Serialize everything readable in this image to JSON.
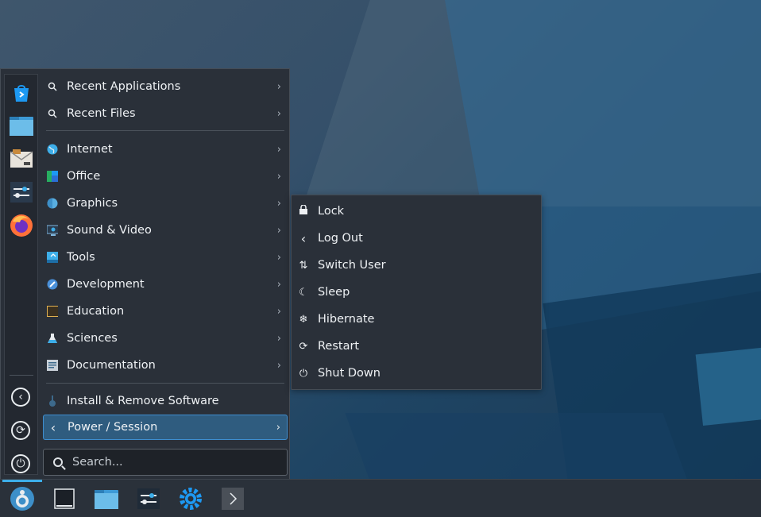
{
  "launcher": {
    "favorites": [
      "discover-icon",
      "file-manager-icon",
      "mail-icon",
      "system-settings-icon",
      "firefox-icon"
    ],
    "system_actions": [
      "leave-icon",
      "switch-user-icon",
      "power-icon"
    ],
    "menu": {
      "recent_applications": "Recent Applications",
      "recent_files": "Recent Files",
      "internet": "Internet",
      "office": "Office",
      "graphics": "Graphics",
      "sound_video": "Sound & Video",
      "tools": "Tools",
      "development": "Development",
      "education": "Education",
      "sciences": "Sciences",
      "documentation": "Documentation",
      "install_remove": "Install & Remove Software",
      "power_session": "Power / Session"
    },
    "search": {
      "placeholder": "Search..."
    }
  },
  "power_menu": {
    "lock": "Lock",
    "log_out": "Log Out",
    "switch_user": "Switch User",
    "sleep": "Sleep",
    "hibernate": "Hibernate",
    "restart": "Restart",
    "shut_down": "Shut Down"
  },
  "taskbar": {
    "items": [
      "application-launcher-icon",
      "show-desktop-icon",
      "file-manager-icon",
      "system-settings-icon",
      "discover-settings-icon",
      "expand-arrow-icon"
    ]
  },
  "colors": {
    "accent": "#3daee9",
    "panel": "#2a3039",
    "highlight": "#2f5c7f"
  }
}
